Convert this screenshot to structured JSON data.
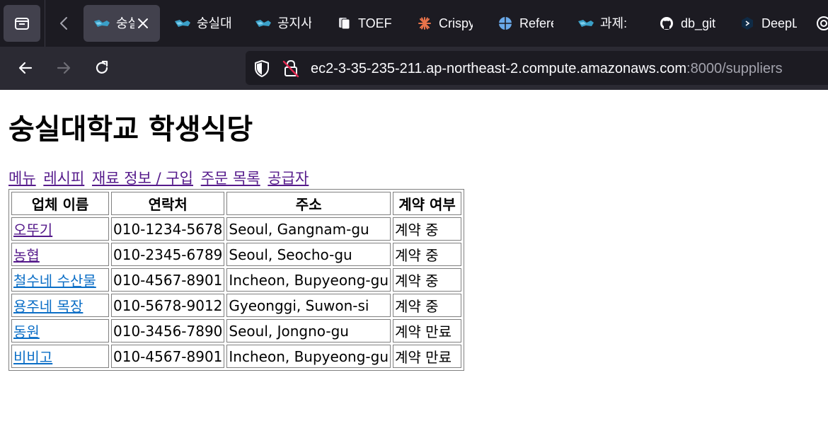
{
  "browser": {
    "tabs": [
      {
        "title": "숭실",
        "active": true,
        "favicon": "ssu-logo-icon"
      },
      {
        "title": "숭실대",
        "active": false,
        "favicon": "ssu-logo-icon"
      },
      {
        "title": "공지사",
        "active": false,
        "favicon": "ssu-logo-icon"
      },
      {
        "title": "TOEFL",
        "active": false,
        "favicon": "document-icon"
      },
      {
        "title": "Crispy",
        "active": false,
        "favicon": "sunburst-icon"
      },
      {
        "title": "Refere",
        "active": false,
        "favicon": "globe-icon"
      },
      {
        "title": "과제:",
        "active": false,
        "favicon": "ssu-logo-icon"
      },
      {
        "title": "db_git",
        "active": false,
        "favicon": "github-icon"
      },
      {
        "title": "DeepL",
        "active": false,
        "favicon": "deepl-icon"
      }
    ],
    "url": {
      "host": "ec2-3-35-235-211.ap-northeast-2.compute.amazonaws.com",
      "rest": ":8000/suppliers"
    }
  },
  "page": {
    "title": "숭실대학교 학생식당",
    "nav": [
      "메뉴",
      "레시피",
      "재료 정보 / 구입",
      "주문 목록",
      "공급자"
    ],
    "table": {
      "headers": [
        "업체 이름",
        "연락처",
        "주소",
        "계약 여부"
      ],
      "rows": [
        {
          "name": "오뚜기",
          "contact": "010-1234-5678",
          "address": "Seoul, Gangnam-gu",
          "status": "계약 중"
        },
        {
          "name": "농협",
          "contact": "010-2345-6789",
          "address": "Seoul, Seocho-gu",
          "status": "계약 중"
        },
        {
          "name": "철수네 수산물",
          "contact": "010-4567-8901",
          "address": "Incheon, Bupyeong-gu",
          "status": "계약 중"
        },
        {
          "name": "용주네 목장",
          "contact": "010-5678-9012",
          "address": "Gyeonggi, Suwon-si",
          "status": "계약 중"
        },
        {
          "name": "동원",
          "contact": "010-3456-7890",
          "address": "Seoul, Jongno-gu",
          "status": "계약 만료"
        },
        {
          "name": "비비고",
          "contact": "010-4567-8901",
          "address": "Incheon, Bupyeong-gu",
          "status": "계약 만료"
        }
      ]
    }
  },
  "colors": {
    "tabstrip": "#1c1b22",
    "toolbar": "#2b2a33",
    "link_visited": "#551a8b",
    "link_unvisited": "#0b6ec6"
  }
}
